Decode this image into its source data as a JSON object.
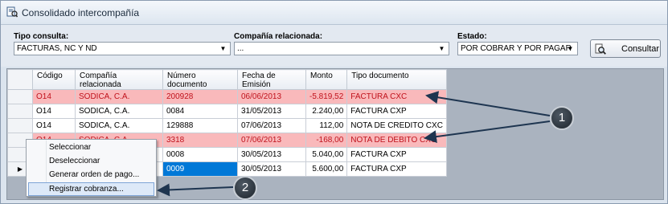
{
  "window": {
    "title": "Consolidado intercompañía"
  },
  "filters": {
    "tipo_consulta": {
      "label": "Tipo consulta:",
      "value": "FACTURAS, NC Y ND"
    },
    "compania": {
      "label": "Compañía relacionada:",
      "value": "..."
    },
    "estado": {
      "label": "Estado:",
      "value": "POR COBRAR Y POR PAGAR"
    },
    "consultar_label": "Consultar"
  },
  "grid": {
    "columns": [
      "Código",
      "Compañía relacionada",
      "Número documento",
      "Fecha de Emisión",
      "Monto",
      "Tipo documento"
    ],
    "rows": [
      {
        "codigo": "O14",
        "compania": "SODICA, C.A.",
        "numero": "200928",
        "fecha": "06/06/2013",
        "monto": "-5.819,52",
        "tipo": "FACTURA CXC",
        "highlight": true
      },
      {
        "codigo": "O14",
        "compania": "SODICA, C.A.",
        "numero": "0084",
        "fecha": "31/05/2013",
        "monto": "2.240,00",
        "tipo": "FACTURA CXP",
        "highlight": false
      },
      {
        "codigo": "O14",
        "compania": "SODICA, C.A.",
        "numero": "129888",
        "fecha": "07/06/2013",
        "monto": "112,00",
        "tipo": "NOTA DE CREDITO CXC",
        "highlight": false
      },
      {
        "codigo": "O14",
        "compania": "SODICA, C.A.",
        "numero": "3318",
        "fecha": "07/06/2013",
        "monto": "-168,00",
        "tipo": "NOTA DE DEBITO CXC",
        "highlight": true
      },
      {
        "codigo": "",
        "compania": "",
        "numero": "0008",
        "fecha": "30/05/2013",
        "monto": "5.040,00",
        "tipo": "FACTURA CXP",
        "highlight": false
      },
      {
        "codigo": "",
        "compania": "",
        "numero": "0009",
        "fecha": "30/05/2013",
        "monto": "5.600,00",
        "tipo": "FACTURA CXP",
        "highlight": false
      }
    ]
  },
  "context_menu": {
    "items": [
      "Seleccionar",
      "Deseleccionar",
      "Generar orden de pago...",
      "Registrar cobranza..."
    ],
    "highlighted_index": 3
  },
  "callouts": [
    "1",
    "2"
  ]
}
